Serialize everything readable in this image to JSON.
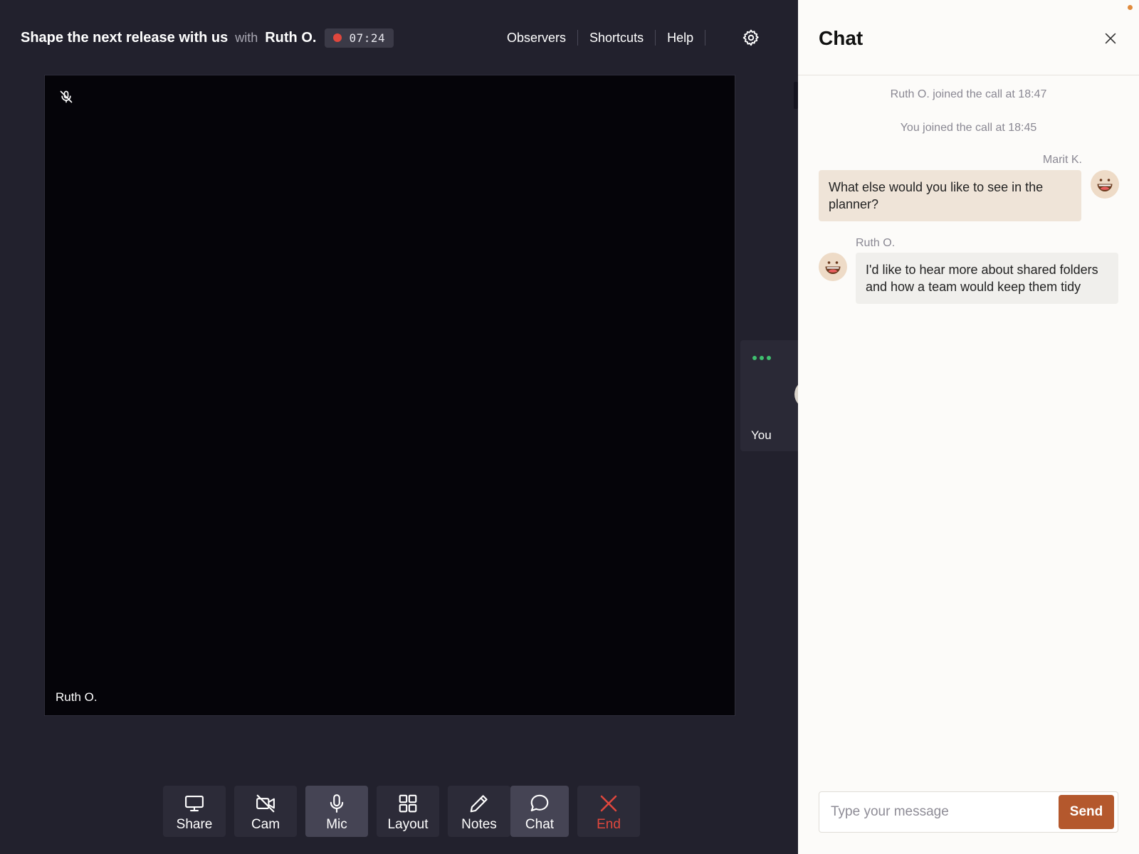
{
  "header": {
    "title": "Shape the next release with us",
    "with_label": "with",
    "participant": "Ruth O.",
    "recording_time": "07:24",
    "nav": [
      "Observers",
      "Shortcuts",
      "Help"
    ],
    "settings_icon": "gear-icon"
  },
  "video": {
    "main_name": "Ruth O.",
    "mute_icon": "mic-off-icon",
    "self_name": "You"
  },
  "toolbar": {
    "share": "Share",
    "cam": "Cam",
    "mic": "Mic",
    "layout": "Layout",
    "notes": "Notes",
    "chat": "Chat",
    "end": "End"
  },
  "chat": {
    "title": "Chat",
    "system": [
      "Ruth O. joined the call at 18:47",
      "You joined the call at 18:45"
    ],
    "messages": [
      {
        "sender": "Marit K.",
        "text": "What else would you like to see in the planner?"
      },
      {
        "sender": "Ruth O.",
        "text": "I'd like to hear more about shared folders and how a team would keep them tidy"
      }
    ],
    "placeholder": "Type your message",
    "send_label": "Send"
  },
  "colors": {
    "background": "#22212d",
    "recording": "#e0473d",
    "send": "#b4582d",
    "own_bubble": "#efe4d8",
    "other_bubble": "#f0efec",
    "typing_dots": "#3fbf6f"
  }
}
